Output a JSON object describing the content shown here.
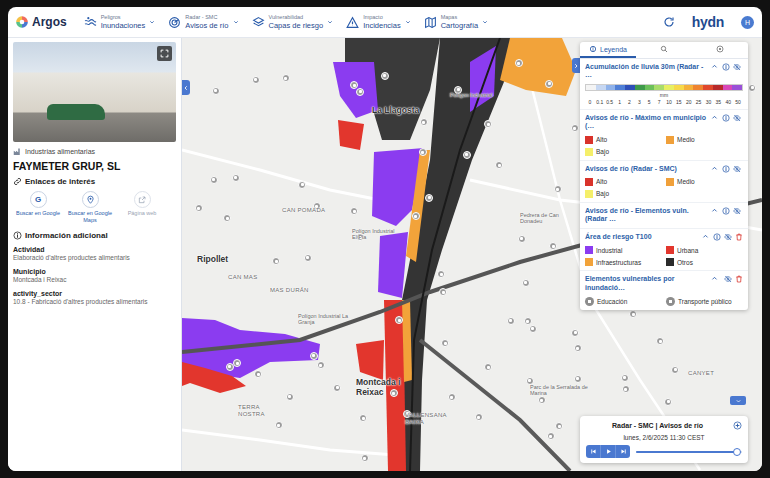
{
  "header": {
    "logo": "Argos",
    "menus": [
      {
        "category": "Peligros",
        "label": "Inundaciones"
      },
      {
        "category": "Radar - SMC",
        "label": "Avisos de río"
      },
      {
        "category": "Vulnerabilidad",
        "label": "Capas de riesgo"
      },
      {
        "category": "Impacto",
        "label": "Incidencias"
      },
      {
        "category": "Mapas",
        "label": "Cartografía"
      }
    ],
    "brand": "hydn",
    "avatar": "H"
  },
  "place": {
    "category": "Industrias alimentarias",
    "title": "FAYMETER GRUP, SL",
    "links_title": "Enlaces de interés",
    "links": [
      {
        "label": "Buscar en Google",
        "glyph": "G",
        "disabled": false
      },
      {
        "label": "Buscar en Google Maps",
        "disabled": false
      },
      {
        "label": "Página web",
        "disabled": true
      }
    ],
    "info_title": "Información adicional",
    "fields": [
      {
        "label": "Actividad",
        "value": "Elaboració d'altres productes alimentaris"
      },
      {
        "label": "Municipio",
        "value": "Montcada i Reixac"
      },
      {
        "label": "activity_sector",
        "value": "10.8 - Fabricació d'altres productes alimentaris"
      }
    ]
  },
  "map": {
    "labels": [
      {
        "text": "La Llagosta",
        "kind": "town"
      },
      {
        "text": "Polígon Industrial",
        "kind": "poi"
      },
      {
        "text": "CAN POMADA",
        "kind": "area"
      },
      {
        "text": "Pedrera de Can Donadeu",
        "kind": "poi"
      },
      {
        "text": "Ripollet",
        "kind": "town"
      },
      {
        "text": "CAN MAS",
        "kind": "area"
      },
      {
        "text": "MAS DURÁN",
        "kind": "area"
      },
      {
        "text": "Polígon Industrial La Granja",
        "kind": "poi"
      },
      {
        "text": "Montcada i Reixac",
        "kind": "town"
      },
      {
        "text": "TERRA NOSTRA",
        "kind": "area"
      },
      {
        "text": "VALLENSANA BAIXA",
        "kind": "area"
      },
      {
        "text": "Parc de la Serralada de Marina",
        "kind": "poi"
      },
      {
        "text": "CANYET",
        "kind": "area"
      },
      {
        "text": "Polígon Industrial El Pla",
        "kind": "poi"
      }
    ]
  },
  "legend": {
    "tabs": [
      {
        "kind": "text",
        "label": "Leyenda",
        "selected": true
      },
      {
        "kind": "search",
        "selected": false
      },
      {
        "kind": "layers",
        "selected": false
      }
    ],
    "sections": [
      {
        "title": "Acumulación de lluvia 30m (Radar - …",
        "kind": "scale",
        "expanded": true,
        "info": true,
        "removable": false,
        "unit": "mm",
        "steps": [
          {
            "label": "0",
            "color": "#f4f4f4"
          },
          {
            "label": "0.1",
            "color": "#c6d7f2"
          },
          {
            "label": "0.5",
            "color": "#8fb2ea"
          },
          {
            "label": "1",
            "color": "#4f7fd6"
          },
          {
            "label": "2",
            "color": "#2e4fb8"
          },
          {
            "label": "3",
            "color": "#3f9a4a"
          },
          {
            "label": "5",
            "color": "#6cc05a"
          },
          {
            "label": "7",
            "color": "#a9dc6a"
          },
          {
            "label": "10",
            "color": "#e8ef62"
          },
          {
            "label": "15",
            "color": "#f7d94a"
          },
          {
            "label": "20",
            "color": "#f5b13a"
          },
          {
            "label": "25",
            "color": "#ef8430"
          },
          {
            "label": "30",
            "color": "#e0482c"
          },
          {
            "label": "35",
            "color": "#b72a2a"
          },
          {
            "label": "40",
            "color": "#d848b8"
          },
          {
            "label": "50",
            "color": "#9a50d8"
          }
        ]
      },
      {
        "title": "Avisos de río - Máximo en municipio (…",
        "kind": "swatches",
        "expanded": true,
        "info": true,
        "removable": false,
        "items": [
          {
            "label": "Alto",
            "color": "#d9332b"
          },
          {
            "label": "Medio",
            "color": "#f0a03a"
          },
          {
            "label": "Bajo",
            "color": "#f5ef6a"
          }
        ]
      },
      {
        "title": "Avisos de río (Radar - SMC)",
        "kind": "swatches",
        "expanded": true,
        "info": true,
        "removable": false,
        "items": [
          {
            "label": "Alto",
            "color": "#d9332b"
          },
          {
            "label": "Medio",
            "color": "#f0a03a"
          },
          {
            "label": "Bajo",
            "color": "#f5ef6a"
          }
        ]
      },
      {
        "title": "Avisos de río - Elementos vuln. (Radar …",
        "kind": "swatches",
        "expanded": true,
        "info": true,
        "removable": false,
        "items": []
      },
      {
        "title": "Área de riesgo T100",
        "kind": "swatches",
        "expanded": true,
        "info": true,
        "removable": true,
        "items": [
          {
            "label": "Industrial",
            "color": "#8b3cf0"
          },
          {
            "label": "Urbana",
            "color": "#e2362d"
          },
          {
            "label": "Infraestructuras",
            "color": "#f2a33a"
          },
          {
            "label": "Otros",
            "color": "#2b2b2b"
          }
        ]
      },
      {
        "title": "Elementos vulnerables por inundació…",
        "kind": "icons",
        "expanded": true,
        "info": false,
        "removable": true,
        "items": [
          {
            "label": "Educación"
          },
          {
            "label": "Transporte público"
          }
        ]
      }
    ]
  },
  "timeline": {
    "title": "Radar - SMC | Avisos de río",
    "date": "lunes, 2/6/2025 11:30 CEST",
    "level": 0.95
  }
}
